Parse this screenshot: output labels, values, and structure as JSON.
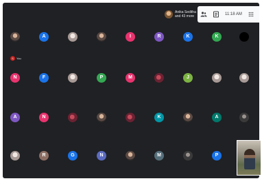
{
  "header": {
    "presenter_line1": "Anika Seditha",
    "presenter_line2": "and 43 more",
    "time": "11:18 AM"
  },
  "self_label": "You",
  "self_initial": "S",
  "participants": [
    {
      "row": 0,
      "col": 0,
      "kind": "photo",
      "letter": ""
    },
    {
      "row": 0,
      "col": 1,
      "kind": "initial",
      "letter": "A",
      "color": "#1a73e8"
    },
    {
      "row": 0,
      "col": 2,
      "kind": "photo-light",
      "letter": ""
    },
    {
      "row": 0,
      "col": 3,
      "kind": "photo",
      "letter": ""
    },
    {
      "row": 0,
      "col": 4,
      "kind": "initial",
      "letter": "I",
      "color": "#e8336e"
    },
    {
      "row": 0,
      "col": 5,
      "kind": "initial",
      "letter": "R",
      "color": "#7e57c2"
    },
    {
      "row": 0,
      "col": 6,
      "kind": "initial",
      "letter": "K",
      "color": "#1a73e8"
    },
    {
      "row": 0,
      "col": 7,
      "kind": "initial",
      "letter": "K",
      "color": "#34a853"
    },
    {
      "row": 0,
      "col": 8,
      "kind": "initial",
      "letter": "",
      "color": "#000000"
    },
    {
      "row": 1,
      "col": 0,
      "kind": "initial",
      "letter": "N",
      "color": "#e8336e"
    },
    {
      "row": 1,
      "col": 1,
      "kind": "initial",
      "letter": "F",
      "color": "#1a73e8"
    },
    {
      "row": 1,
      "col": 2,
      "kind": "photo-light",
      "letter": ""
    },
    {
      "row": 1,
      "col": 3,
      "kind": "initial",
      "letter": "P",
      "color": "#34a853"
    },
    {
      "row": 1,
      "col": 4,
      "kind": "initial",
      "letter": "M",
      "color": "#e8336e"
    },
    {
      "row": 1,
      "col": 5,
      "kind": "photo-red",
      "letter": ""
    },
    {
      "row": 1,
      "col": 6,
      "kind": "initial",
      "letter": "J",
      "color": "#7cb342"
    },
    {
      "row": 1,
      "col": 7,
      "kind": "photo-light",
      "letter": ""
    },
    {
      "row": 1,
      "col": 8,
      "kind": "photo-light",
      "letter": ""
    },
    {
      "row": 2,
      "col": 0,
      "kind": "initial",
      "letter": "A",
      "color": "#7e57c2"
    },
    {
      "row": 2,
      "col": 1,
      "kind": "initial",
      "letter": "N",
      "color": "#e8336e"
    },
    {
      "row": 2,
      "col": 2,
      "kind": "photo-red",
      "letter": ""
    },
    {
      "row": 2,
      "col": 3,
      "kind": "photo",
      "letter": ""
    },
    {
      "row": 2,
      "col": 4,
      "kind": "photo-red",
      "letter": ""
    },
    {
      "row": 2,
      "col": 5,
      "kind": "initial",
      "letter": "K",
      "color": "#0097a7"
    },
    {
      "row": 2,
      "col": 6,
      "kind": "photo",
      "letter": ""
    },
    {
      "row": 2,
      "col": 7,
      "kind": "initial",
      "letter": "A",
      "color": "#00796b"
    },
    {
      "row": 2,
      "col": 8,
      "kind": "photo-dark",
      "letter": ""
    },
    {
      "row": 3,
      "col": 0,
      "kind": "photo-light",
      "letter": ""
    },
    {
      "row": 3,
      "col": 1,
      "kind": "initial",
      "letter": "R",
      "color": "#8d6e63"
    },
    {
      "row": 3,
      "col": 2,
      "kind": "initial",
      "letter": "G",
      "color": "#1a73e8"
    },
    {
      "row": 3,
      "col": 3,
      "kind": "initial",
      "letter": "N",
      "color": "#5c6bc0"
    },
    {
      "row": 3,
      "col": 4,
      "kind": "photo",
      "letter": ""
    },
    {
      "row": 3,
      "col": 5,
      "kind": "initial",
      "letter": "M",
      "color": "#546e7a"
    },
    {
      "row": 3,
      "col": 6,
      "kind": "photo-dark",
      "letter": ""
    },
    {
      "row": 3,
      "col": 7,
      "kind": "initial",
      "letter": "P",
      "color": "#1a73e8"
    }
  ]
}
